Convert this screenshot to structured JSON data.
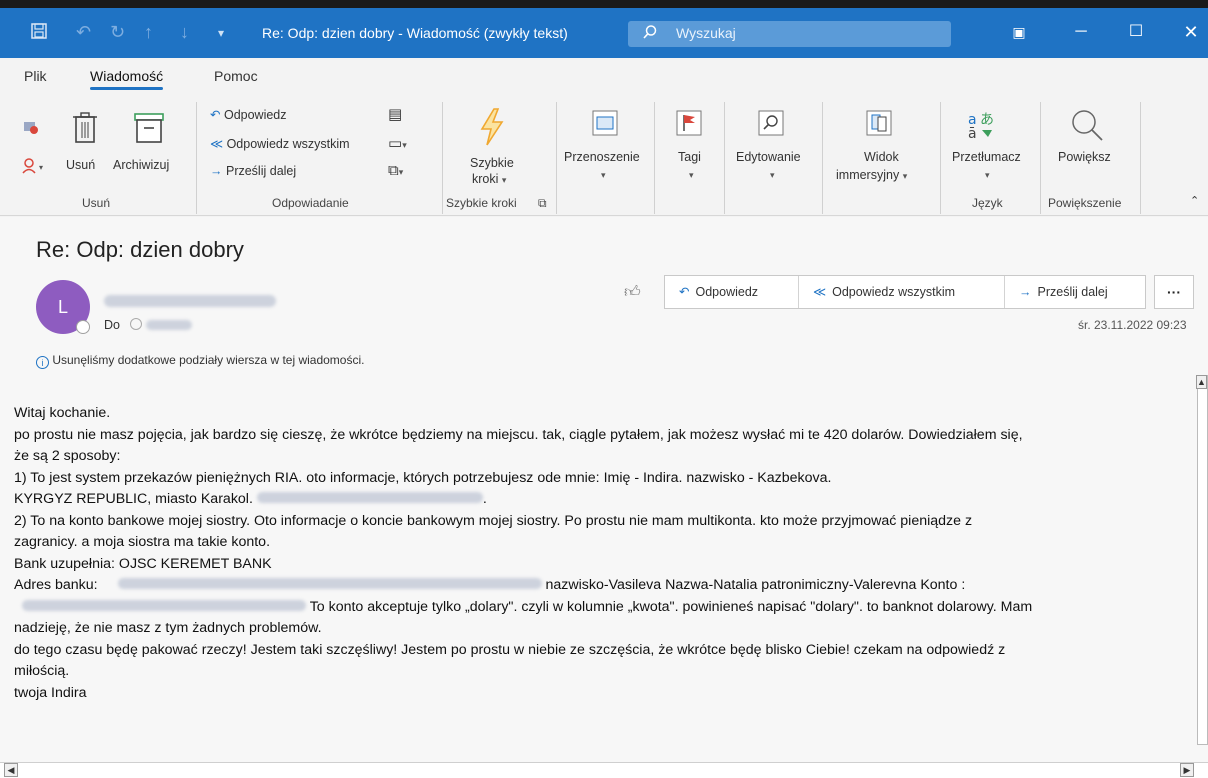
{
  "window": {
    "title": "Re: Odp: dzien dobry  -  Wiadomość (zwykły tekst)",
    "search_placeholder": "Wyszukaj"
  },
  "ribbon": {
    "tabs": [
      "Plik",
      "Wiadomość",
      "Pomoc"
    ],
    "groups": {
      "usun": {
        "label": "Usuń",
        "delete": "Usuń",
        "archive": "Archiwizuj"
      },
      "odpowiadanie": {
        "label": "Odpowiadanie",
        "reply": "Odpowiedz",
        "reply_all": "Odpowiedz wszystkim",
        "forward": "Prześlij dalej"
      },
      "szybkie": {
        "label": "Szybkie kroki",
        "button_line1": "Szybkie",
        "button_line2": "kroki"
      },
      "move": {
        "label": "Przenoszenie"
      },
      "tags": {
        "label": "Tagi"
      },
      "edit": {
        "label": "Edytowanie"
      },
      "immersive": {
        "line1": "Widok",
        "line2": "immersyjny"
      },
      "translate": {
        "label": "Przetłumacz",
        "group_label": "Język"
      },
      "zoom": {
        "label": "Powiększ",
        "group_label": "Powiększenie"
      }
    }
  },
  "message": {
    "subject": "Re: Odp: dzien dobry",
    "avatar_initial": "L",
    "to_label": "Do",
    "date": "śr. 23.11.2022 09:23",
    "info": "Usunęliśmy dodatkowe podziały wiersza w tej wiadomości.",
    "actions": {
      "reply": "Odpowiedz",
      "reply_all": "Odpowiedz wszystkim",
      "forward": "Prześlij dalej",
      "more": "···"
    },
    "body": {
      "l1": "Witaj kochanie.",
      "l2": "po prostu nie masz pojęcia, jak bardzo się cieszę, że wkrótce będziemy na miejscu. tak, ciągle pytałem, jak możesz wysłać mi te 420 dolarów. Dowiedziałem się,",
      "l3": "że są 2 sposoby:",
      "l4": "1) To jest system przekazów pieniężnych RIA. oto informacje, których potrzebujesz ode mnie: Imię - Indira. nazwisko - Kazbekova.",
      "l5a": "KYRGYZ REPUBLIC, miasto Karakol.",
      "l5b": ".",
      "l6": "2) To na konto bankowe mojej siostry. Oto informacje o koncie bankowym mojej siostry. Po prostu nie mam multikonta. kto może przyjmować pieniądze z",
      "l7": "zagranicy. a moja siostra ma takie konto.",
      "l8": "Bank uzupełnia: OJSC KEREMET BANK",
      "l9a": "Adres banku:",
      "l9b": "nazwisko-Vasileva Nazwa-Natalia patronimiczny-Valerevna Konto :",
      "l10": "To konto akceptuje tylko „dolary\". czyli w kolumnie „kwota\". powinieneś napisać \"dolary\". to banknot dolarowy. Mam",
      "l11": "nadzieję, że nie masz z tym żadnych problemów.",
      "l12": "do tego czasu będę pakować rzeczy! Jestem taki szczęśliwy! Jestem po prostu w niebie ze szczęścia, że wkrótce będę blisko Ciebie! czekam na odpowiedź z",
      "l13": "miłością.",
      "l14": "twoja Indira"
    }
  }
}
